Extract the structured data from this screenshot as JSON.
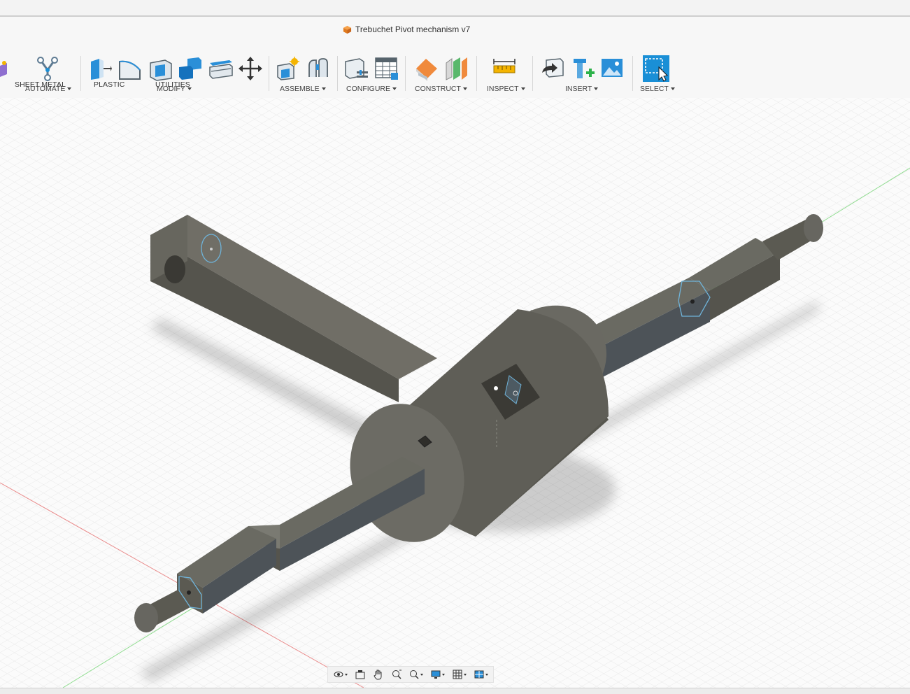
{
  "window": {
    "document_title": "Trebuchet Pivot mechanism v7"
  },
  "tabs": [
    {
      "label": "SHEET METAL"
    },
    {
      "label": "PLASTIC"
    },
    {
      "label": "UTILITIES"
    }
  ],
  "toolbar": {
    "groups": [
      {
        "label": "AUTOMATE"
      },
      {
        "label": "MODIFY"
      },
      {
        "label": "ASSEMBLE"
      },
      {
        "label": "CONFIGURE"
      },
      {
        "label": "CONSTRUCT"
      },
      {
        "label": "INSPECT"
      },
      {
        "label": "INSERT"
      },
      {
        "label": "SELECT"
      }
    ]
  },
  "colors": {
    "accent_blue": "#1a8fd6",
    "body_dark": "#5b5a52",
    "steel": "#5f6e76",
    "grid_line": "#e6e6e6",
    "axis_red": "#e98b8b",
    "axis_green": "#8fdc8f"
  },
  "navigation_bar": {
    "icons": [
      "orbit-icon",
      "look-at-icon",
      "pan-icon",
      "zoom-icon",
      "zoom-window-icon",
      "display-settings-icon",
      "grid-settings-icon",
      "viewports-icon"
    ]
  }
}
